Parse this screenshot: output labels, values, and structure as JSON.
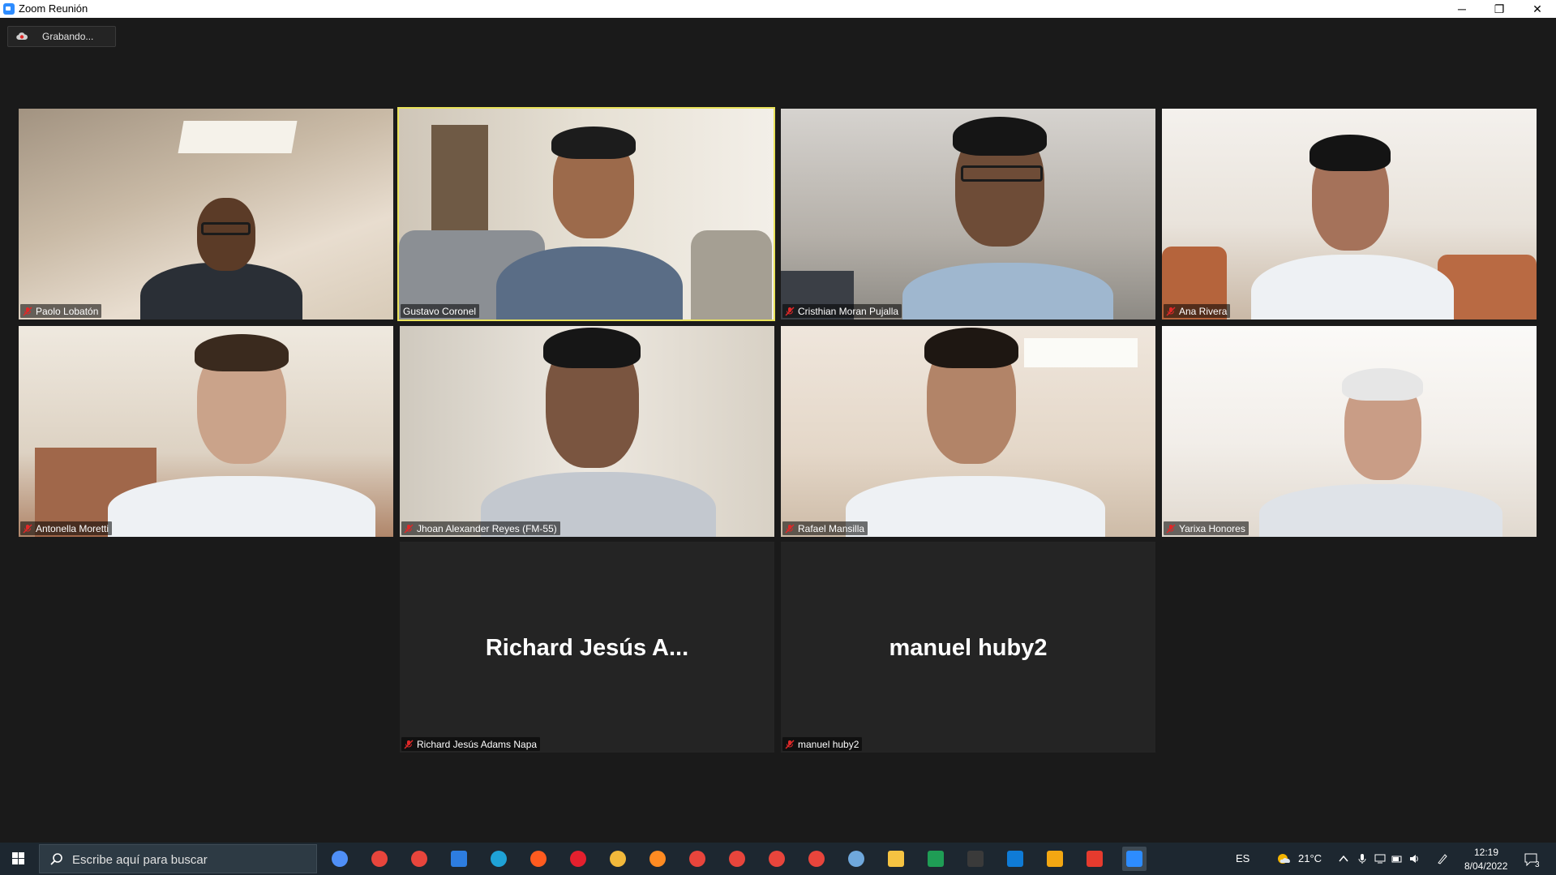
{
  "window": {
    "title": "Zoom Reunión",
    "minimize_glyph": "─",
    "maximize_glyph": "❐",
    "close_glyph": "✕"
  },
  "recording": {
    "label": "Grabando..."
  },
  "participants": [
    {
      "name": "Paolo Lobatón",
      "muted": true,
      "video": true
    },
    {
      "name": "Gustavo Coronel",
      "muted": false,
      "video": true,
      "active_speaker": true
    },
    {
      "name": "Cristhian Moran Pujalla",
      "muted": true,
      "video": true
    },
    {
      "name": "Ana Rivera",
      "muted": true,
      "video": true
    },
    {
      "name": "Antonella Moretti",
      "muted": true,
      "video": true
    },
    {
      "name": "Jhoan Alexander Reyes (FM-55)",
      "muted": true,
      "video": true
    },
    {
      "name": "Rafael Mansilla",
      "muted": true,
      "video": true
    },
    {
      "name": "Yarixa Honores",
      "muted": true,
      "video": true
    },
    {
      "name": "Richard Jesús Adams Napa",
      "display_name": "Richard Jesús A...",
      "muted": true,
      "video": false
    },
    {
      "name": "manuel huby2",
      "display_name": "manuel huby2",
      "muted": true,
      "video": false
    }
  ],
  "taskbar": {
    "search_placeholder": "Escribe aquí para buscar",
    "apps": [
      "cortana-icon",
      "chrome-icon",
      "chrome-icon",
      "mail-icon",
      "edge-icon",
      "brave-icon",
      "opera-icon",
      "vpn-icon",
      "firefox-icon",
      "chrome-icon",
      "chrome-icon",
      "chrome-icon",
      "chrome-icon",
      "paint-icon",
      "file-explorer-icon",
      "excel-icon",
      "terminal-icon",
      "vscode-icon",
      "sublime-icon",
      "anydesk-icon",
      "zoom-icon"
    ],
    "language": "ES",
    "weather": "21°C",
    "time": "12:19",
    "date": "8/04/2022",
    "notification_count": "3"
  },
  "colors": {
    "active_speaker_border": "#e9e25a",
    "zoom_blue": "#2d8cff",
    "muted_red": "#e02828"
  }
}
